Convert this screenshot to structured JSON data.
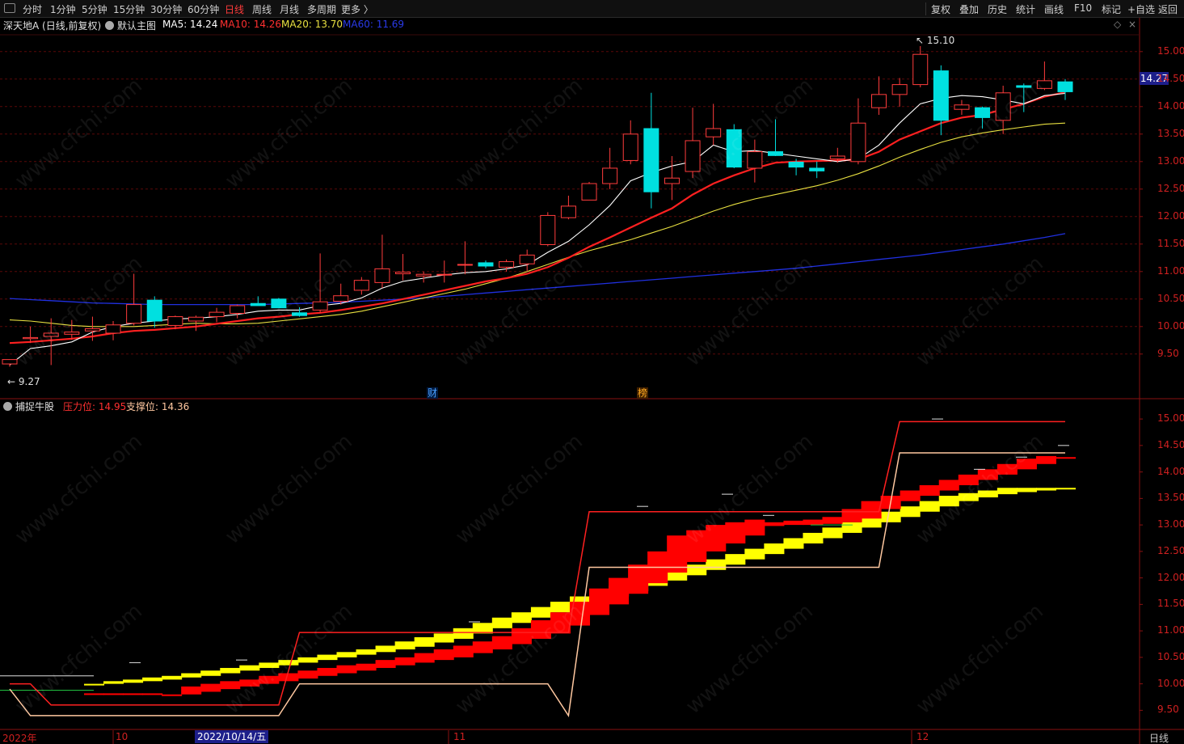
{
  "toolbar": {
    "left": [
      "分时",
      "1分钟",
      "5分钟",
      "15分钟",
      "30分钟",
      "60分钟",
      "日线",
      "周线",
      "月线",
      "多周期",
      "更多 〉"
    ],
    "active": "日线",
    "right": [
      "复权",
      "叠加",
      "历史",
      "统计",
      "画线",
      "F10",
      "标记",
      "+自选",
      "返回"
    ]
  },
  "main_legend": {
    "stock": "深天地A (日线,前复权)",
    "indicator": "默认主图",
    "ma5": "MA5: 14.24",
    "ma10": "MA10: 14.26",
    "ma20": "MA20: 13.70",
    "ma60": "MA60: 11.69"
  },
  "sub_legend": {
    "name": "捕捉牛股",
    "pressure": "压力位: 14.95",
    "support": "支撑位: 14.36"
  },
  "markers": {
    "high": "15.10",
    "low": "9.27",
    "cai": "财",
    "bang": "榜",
    "current_price": "14.27"
  },
  "dates": {
    "year": "2022年",
    "m10": "10",
    "cursor_date": "2022/10/14/五",
    "m11": "11",
    "m12": "12",
    "period": "日线"
  },
  "axis_main": [
    "15.00",
    "14.50",
    "14.00",
    "13.50",
    "13.00",
    "12.50",
    "12.00",
    "11.50",
    "11.00",
    "10.50",
    "10.00",
    "9.50"
  ],
  "axis_sub": [
    "15.00",
    "14.50",
    "14.00",
    "13.50",
    "13.00",
    "12.50",
    "12.00",
    "11.50",
    "11.00",
    "10.50",
    "10.00",
    "9.50"
  ],
  "watermark": "www.cfchi.com",
  "colors": {
    "up": "#ff3c3c",
    "down": "#00e0e0",
    "ma5": "#ffffff",
    "ma10": "#ff2020",
    "ma20": "#e8e040",
    "ma60": "#2030e0",
    "pressure": "#ff2020",
    "support": "#ffc8a0",
    "band_red": "#ff0000",
    "band_yellow": "#ffff00"
  },
  "chart_data": {
    "type": "candlestick",
    "candles": [
      {
        "o": 9.32,
        "h": 9.4,
        "l": 9.27,
        "c": 9.4
      },
      {
        "o": 9.78,
        "h": 10.0,
        "l": 9.7,
        "c": 9.8
      },
      {
        "o": 9.82,
        "h": 10.15,
        "l": 9.3,
        "c": 9.88
      },
      {
        "o": 9.86,
        "h": 10.12,
        "l": 9.76,
        "c": 9.9
      },
      {
        "o": 9.92,
        "h": 10.18,
        "l": 9.74,
        "c": 9.96
      },
      {
        "o": 9.88,
        "h": 10.1,
        "l": 9.75,
        "c": 10.03
      },
      {
        "o": 10.06,
        "h": 10.96,
        "l": 10.02,
        "c": 10.4
      },
      {
        "o": 10.48,
        "h": 10.55,
        "l": 9.98,
        "c": 10.1
      },
      {
        "o": 10.02,
        "h": 10.2,
        "l": 9.95,
        "c": 10.18
      },
      {
        "o": 10.1,
        "h": 10.2,
        "l": 9.92,
        "c": 10.17
      },
      {
        "o": 10.18,
        "h": 10.34,
        "l": 10.08,
        "c": 10.26
      },
      {
        "o": 10.24,
        "h": 10.4,
        "l": 10.15,
        "c": 10.38
      },
      {
        "o": 10.42,
        "h": 10.55,
        "l": 10.38,
        "c": 10.38
      },
      {
        "o": 10.5,
        "h": 10.52,
        "l": 10.34,
        "c": 10.34
      },
      {
        "o": 10.25,
        "h": 10.35,
        "l": 10.18,
        "c": 10.2
      },
      {
        "o": 10.3,
        "h": 11.33,
        "l": 10.25,
        "c": 10.45
      },
      {
        "o": 10.46,
        "h": 10.78,
        "l": 10.4,
        "c": 10.56
      },
      {
        "o": 10.66,
        "h": 10.9,
        "l": 10.58,
        "c": 10.84
      },
      {
        "o": 10.8,
        "h": 11.67,
        "l": 10.7,
        "c": 11.05
      },
      {
        "o": 10.96,
        "h": 11.32,
        "l": 10.84,
        "c": 10.99
      },
      {
        "o": 10.92,
        "h": 11.0,
        "l": 10.8,
        "c": 10.95
      },
      {
        "o": 10.95,
        "h": 11.2,
        "l": 10.8,
        "c": 10.95
      },
      {
        "o": 11.13,
        "h": 11.55,
        "l": 10.95,
        "c": 11.13
      },
      {
        "o": 11.16,
        "h": 11.2,
        "l": 11.06,
        "c": 11.1
      },
      {
        "o": 11.08,
        "h": 11.22,
        "l": 11.0,
        "c": 11.18
      },
      {
        "o": 11.14,
        "h": 11.4,
        "l": 11.0,
        "c": 11.3
      },
      {
        "o": 11.49,
        "h": 12.08,
        "l": 11.46,
        "c": 12.02
      },
      {
        "o": 11.98,
        "h": 12.38,
        "l": 11.95,
        "c": 12.19
      },
      {
        "o": 12.3,
        "h": 12.63,
        "l": 12.3,
        "c": 12.6
      },
      {
        "o": 12.6,
        "h": 13.25,
        "l": 12.5,
        "c": 12.88
      },
      {
        "o": 13.02,
        "h": 13.75,
        "l": 12.95,
        "c": 13.5
      },
      {
        "o": 13.6,
        "h": 14.25,
        "l": 12.15,
        "c": 12.45
      },
      {
        "o": 12.6,
        "h": 13.1,
        "l": 12.3,
        "c": 12.7
      },
      {
        "o": 12.82,
        "h": 13.98,
        "l": 12.7,
        "c": 13.38
      },
      {
        "o": 13.45,
        "h": 14.05,
        "l": 13.3,
        "c": 13.6
      },
      {
        "o": 13.58,
        "h": 13.68,
        "l": 12.88,
        "c": 12.9
      },
      {
        "o": 12.88,
        "h": 13.4,
        "l": 12.62,
        "c": 13.18
      },
      {
        "o": 13.18,
        "h": 13.77,
        "l": 13.1,
        "c": 13.11
      },
      {
        "o": 12.99,
        "h": 13.05,
        "l": 12.75,
        "c": 12.9
      },
      {
        "o": 12.88,
        "h": 13.0,
        "l": 12.7,
        "c": 12.83
      },
      {
        "o": 13.05,
        "h": 13.25,
        "l": 12.98,
        "c": 13.1
      },
      {
        "o": 13.0,
        "h": 14.15,
        "l": 12.95,
        "c": 13.7
      },
      {
        "o": 13.98,
        "h": 14.55,
        "l": 13.85,
        "c": 14.22
      },
      {
        "o": 14.22,
        "h": 14.52,
        "l": 14.0,
        "c": 14.4
      },
      {
        "o": 14.4,
        "h": 15.1,
        "l": 14.35,
        "c": 14.95
      },
      {
        "o": 14.65,
        "h": 14.75,
        "l": 13.48,
        "c": 13.75
      },
      {
        "o": 13.95,
        "h": 14.12,
        "l": 13.85,
        "c": 14.03
      },
      {
        "o": 13.98,
        "h": 14.0,
        "l": 13.6,
        "c": 13.8
      },
      {
        "o": 13.75,
        "h": 14.38,
        "l": 13.5,
        "c": 14.25
      },
      {
        "o": 14.38,
        "h": 14.42,
        "l": 13.9,
        "c": 14.35
      },
      {
        "o": 14.33,
        "h": 14.82,
        "l": 14.3,
        "c": 14.47
      },
      {
        "o": 14.45,
        "h": 14.5,
        "l": 14.12,
        "c": 14.27
      }
    ],
    "ma5": [
      9.3,
      9.6,
      9.65,
      9.72,
      9.9,
      10.0,
      10.06,
      10.1,
      10.14,
      10.15,
      10.18,
      10.22,
      10.28,
      10.3,
      10.3,
      10.38,
      10.42,
      10.52,
      10.7,
      10.82,
      10.88,
      10.94,
      10.98,
      11.0,
      11.05,
      11.12,
      11.35,
      11.55,
      11.85,
      12.2,
      12.65,
      12.8,
      12.92,
      13.0,
      13.3,
      13.18,
      13.2,
      13.15,
      13.1,
      13.05,
      13.0,
      13.05,
      13.3,
      13.7,
      14.05,
      14.15,
      14.2,
      14.18,
      14.12,
      14.05,
      14.2,
      14.24
    ],
    "ma10": [
      9.7,
      9.72,
      9.75,
      9.78,
      9.82,
      9.88,
      9.92,
      9.94,
      9.97,
      10.0,
      10.05,
      10.1,
      10.15,
      10.18,
      10.22,
      10.25,
      10.3,
      10.36,
      10.42,
      10.5,
      10.58,
      10.66,
      10.74,
      10.82,
      10.88,
      10.96,
      11.08,
      11.25,
      11.45,
      11.62,
      11.8,
      11.98,
      12.15,
      12.4,
      12.6,
      12.75,
      12.88,
      12.98,
      13.0,
      13.01,
      13.02,
      13.04,
      13.18,
      13.4,
      13.55,
      13.7,
      13.8,
      13.85,
      13.95,
      14.05,
      14.18,
      14.26
    ],
    "ma20": [
      10.12,
      10.1,
      10.06,
      10.02,
      10.0,
      10.0,
      10.0,
      10.02,
      10.04,
      10.06,
      10.05,
      10.05,
      10.06,
      10.1,
      10.14,
      10.18,
      10.22,
      10.28,
      10.36,
      10.44,
      10.52,
      10.6,
      10.68,
      10.78,
      10.88,
      11.0,
      11.13,
      11.26,
      11.38,
      11.48,
      11.58,
      11.7,
      11.82,
      11.96,
      12.1,
      12.22,
      12.32,
      12.4,
      12.48,
      12.56,
      12.66,
      12.78,
      12.92,
      13.08,
      13.22,
      13.35,
      13.45,
      13.52,
      13.58,
      13.63,
      13.68,
      13.7
    ],
    "ma60": [
      10.51,
      10.49,
      10.47,
      10.45,
      10.43,
      10.42,
      10.41,
      10.4,
      10.4,
      10.4,
      10.4,
      10.4,
      10.4,
      10.41,
      10.42,
      10.43,
      10.44,
      10.46,
      10.48,
      10.5,
      10.52,
      10.55,
      10.58,
      10.61,
      10.64,
      10.67,
      10.7,
      10.73,
      10.76,
      10.79,
      10.82,
      10.85,
      10.88,
      10.91,
      10.94,
      10.97,
      11.0,
      11.03,
      11.06,
      11.1,
      11.14,
      11.18,
      11.22,
      11.26,
      11.3,
      11.35,
      11.4,
      11.45,
      11.5,
      11.56,
      11.62,
      11.69
    ],
    "pressure": [
      10.0,
      10.0,
      9.6,
      9.6,
      9.6,
      9.6,
      9.6,
      9.6,
      9.6,
      9.6,
      9.6,
      9.6,
      9.6,
      9.6,
      10.97,
      10.97,
      10.97,
      10.97,
      10.97,
      10.97,
      10.97,
      10.97,
      10.97,
      10.97,
      10.97,
      10.97,
      10.97,
      10.97,
      13.25,
      13.25,
      13.25,
      13.25,
      13.25,
      13.25,
      13.25,
      13.25,
      13.25,
      13.25,
      13.25,
      13.25,
      13.25,
      13.25,
      13.25,
      14.95,
      14.95,
      14.95,
      14.95,
      14.95,
      14.95,
      14.95,
      14.95,
      14.95
    ],
    "support": [
      9.9,
      9.4,
      9.4,
      9.4,
      9.4,
      9.4,
      9.4,
      9.4,
      9.4,
      9.4,
      9.4,
      9.4,
      9.4,
      9.4,
      10.0,
      10.0,
      10.0,
      10.0,
      10.0,
      10.0,
      10.0,
      10.0,
      10.0,
      10.0,
      10.0,
      10.0,
      10.0,
      9.4,
      12.2,
      12.2,
      12.2,
      12.2,
      12.2,
      12.2,
      12.2,
      12.2,
      12.2,
      12.2,
      12.2,
      12.2,
      12.2,
      12.2,
      12.2,
      14.36,
      14.36,
      14.36,
      14.36,
      14.36,
      14.36,
      14.36,
      14.36,
      14.36
    ],
    "band_red": [
      [
        9.82,
        9.82
      ],
      [
        9.82,
        9.82
      ],
      [
        9.82,
        9.82
      ],
      [
        9.82,
        9.82
      ],
      [
        9.82,
        9.8
      ],
      [
        9.8,
        9.95
      ],
      [
        9.85,
        10.0
      ],
      [
        9.9,
        10.05
      ],
      [
        9.95,
        10.08
      ],
      [
        10.0,
        10.15
      ],
      [
        10.05,
        10.2
      ],
      [
        10.1,
        10.25
      ],
      [
        10.15,
        10.3
      ],
      [
        10.2,
        10.35
      ],
      [
        10.25,
        10.38
      ],
      [
        10.3,
        10.45
      ],
      [
        10.35,
        10.5
      ],
      [
        10.4,
        10.58
      ],
      [
        10.45,
        10.65
      ],
      [
        10.5,
        10.72
      ],
      [
        10.58,
        10.8
      ],
      [
        10.65,
        10.9
      ],
      [
        10.75,
        11.05
      ],
      [
        10.85,
        11.2
      ],
      [
        10.95,
        11.35
      ],
      [
        11.1,
        11.55
      ],
      [
        11.3,
        11.8
      ],
      [
        11.5,
        12.0
      ],
      [
        11.7,
        12.25
      ],
      [
        11.9,
        12.5
      ],
      [
        12.1,
        12.8
      ],
      [
        12.3,
        12.9
      ],
      [
        12.5,
        13.0
      ],
      [
        12.65,
        13.05
      ],
      [
        12.8,
        13.1
      ],
      [
        12.98,
        13.05
      ],
      [
        13.0,
        13.08
      ],
      [
        13.0,
        13.1
      ],
      [
        13.02,
        13.15
      ],
      [
        13.05,
        13.3
      ],
      [
        13.12,
        13.45
      ],
      [
        13.3,
        13.55
      ],
      [
        13.45,
        13.65
      ],
      [
        13.55,
        13.75
      ],
      [
        13.65,
        13.85
      ],
      [
        13.75,
        13.95
      ],
      [
        13.85,
        14.05
      ],
      [
        13.95,
        14.15
      ],
      [
        14.05,
        14.25
      ],
      [
        14.15,
        14.3
      ],
      [
        14.25,
        14.28
      ]
    ],
    "band_yellow": [
      [
        10.0,
        10.0
      ],
      [
        10.0,
        10.05
      ],
      [
        10.02,
        10.08
      ],
      [
        10.05,
        10.12
      ],
      [
        10.08,
        10.15
      ],
      [
        10.12,
        10.2
      ],
      [
        10.15,
        10.25
      ],
      [
        10.2,
        10.3
      ],
      [
        10.25,
        10.35
      ],
      [
        10.3,
        10.4
      ],
      [
        10.35,
        10.45
      ],
      [
        10.4,
        10.5
      ],
      [
        10.45,
        10.55
      ],
      [
        10.5,
        10.6
      ],
      [
        10.55,
        10.65
      ],
      [
        10.6,
        10.72
      ],
      [
        10.65,
        10.8
      ],
      [
        10.7,
        10.88
      ],
      [
        10.78,
        10.95
      ],
      [
        10.85,
        11.05
      ],
      [
        10.95,
        11.15
      ],
      [
        11.05,
        11.25
      ],
      [
        11.15,
        11.35
      ],
      [
        11.25,
        11.45
      ],
      [
        11.35,
        11.55
      ],
      [
        11.45,
        11.65
      ],
      [
        11.55,
        11.75
      ],
      [
        11.65,
        11.85
      ],
      [
        11.75,
        11.95
      ],
      [
        11.85,
        12.05
      ],
      [
        11.95,
        12.15
      ],
      [
        12.05,
        12.25
      ],
      [
        12.15,
        12.35
      ],
      [
        12.25,
        12.45
      ],
      [
        12.35,
        12.55
      ],
      [
        12.45,
        12.65
      ],
      [
        12.55,
        12.75
      ],
      [
        12.65,
        12.85
      ],
      [
        12.75,
        12.95
      ],
      [
        12.85,
        13.05
      ],
      [
        12.95,
        13.15
      ],
      [
        13.05,
        13.25
      ],
      [
        13.15,
        13.35
      ],
      [
        13.25,
        13.45
      ],
      [
        13.35,
        13.55
      ],
      [
        13.45,
        13.6
      ],
      [
        13.52,
        13.65
      ],
      [
        13.58,
        13.7
      ],
      [
        13.62,
        13.7
      ],
      [
        13.65,
        13.7
      ],
      [
        13.68,
        13.7
      ]
    ],
    "ylim_main": [
      9.1,
      15.35
    ],
    "ylim_sub": [
      9.2,
      15.2
    ]
  }
}
